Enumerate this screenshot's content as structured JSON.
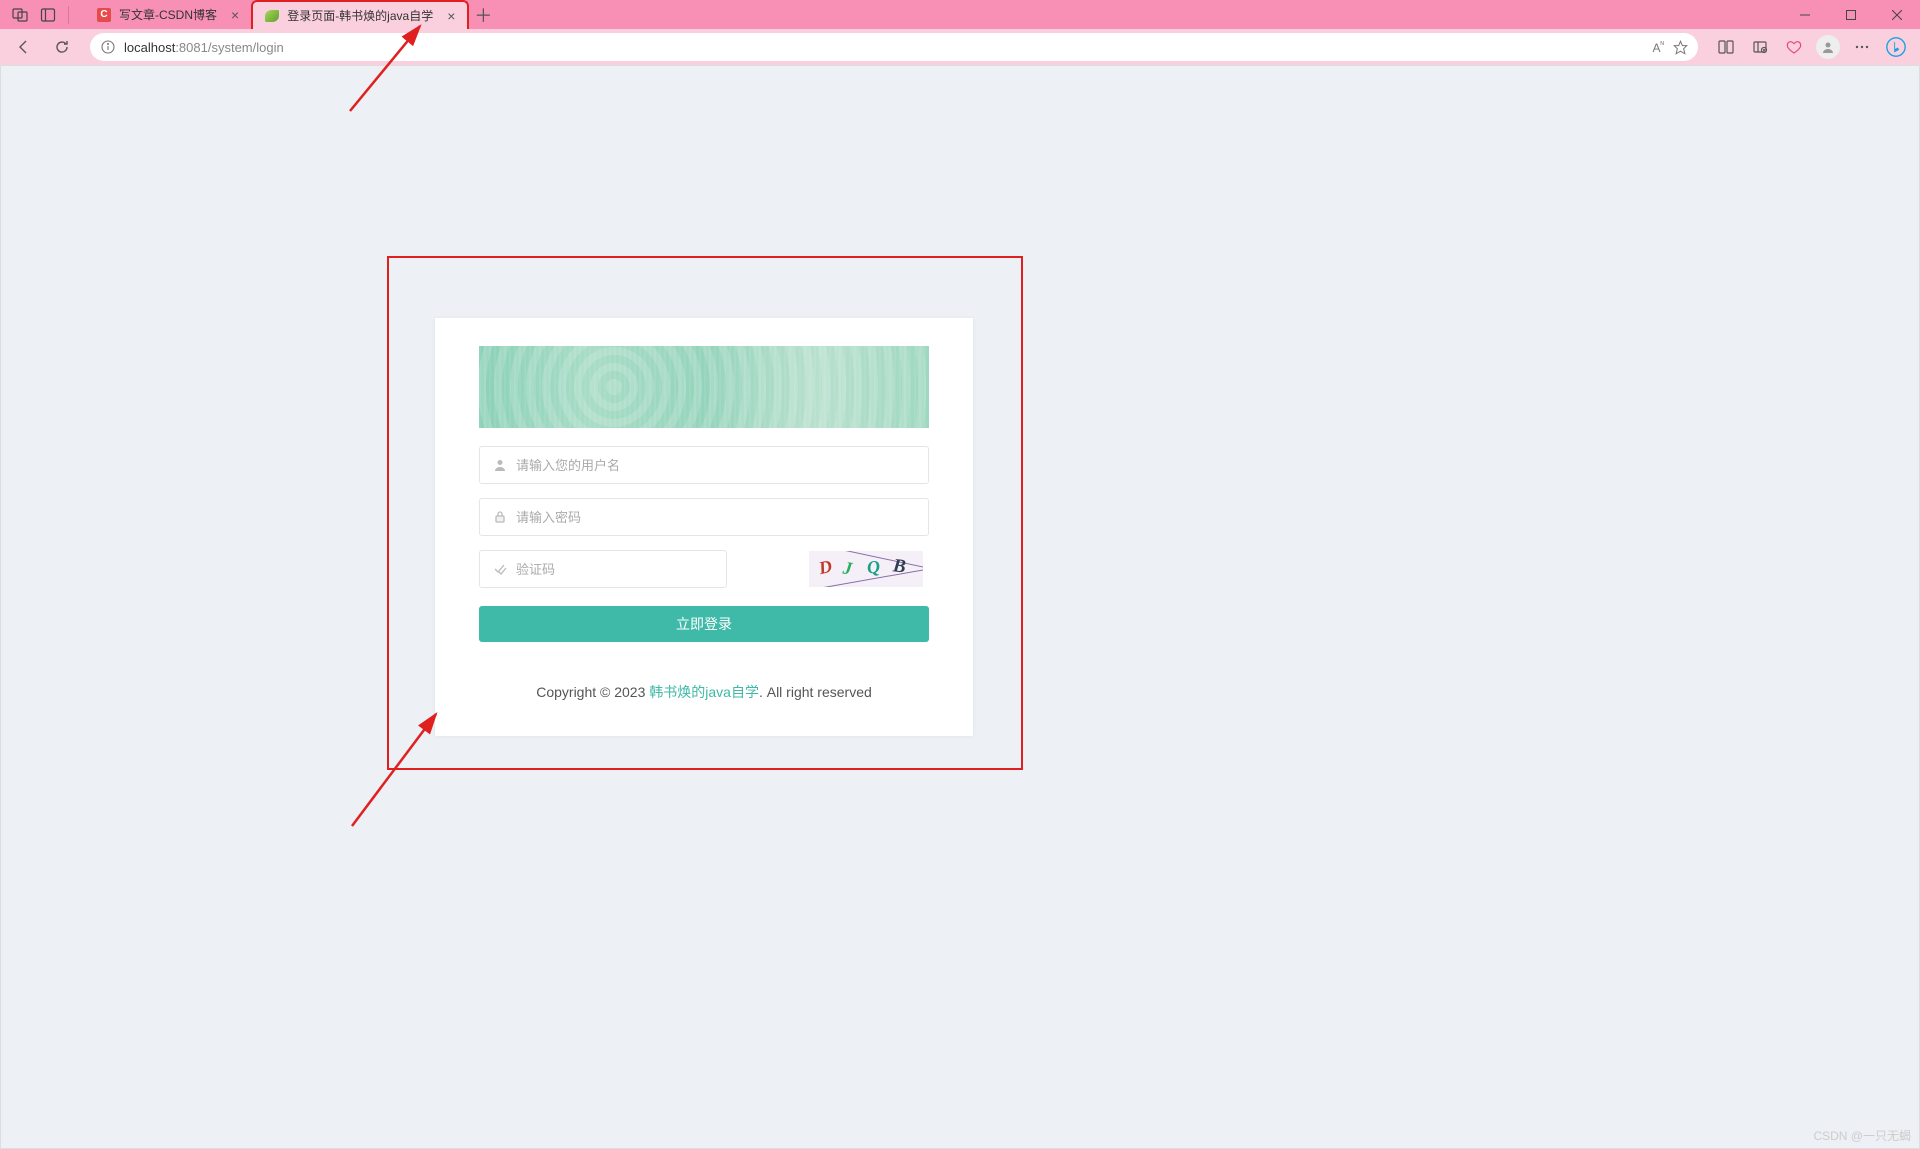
{
  "tabs": [
    {
      "title": "写文章-CSDN博客",
      "favicon": "C",
      "active": false
    },
    {
      "title": "登录页面-韩书焕的java自学",
      "favicon": "leaf",
      "active": true
    }
  ],
  "address": {
    "host": "localhost",
    "rest": ":8081/system/login",
    "font_label": "A"
  },
  "login": {
    "username_placeholder": "请输入您的用户名",
    "password_placeholder": "请输入密码",
    "captcha_placeholder": "验证码",
    "captcha_text": "DJQB",
    "submit_label": "立即登录"
  },
  "footer": {
    "prefix": "Copyright © 2023 ",
    "link": "韩书焕的java自学",
    "suffix": ". All right reserved"
  },
  "watermark": "CSDN @一只无蝎"
}
